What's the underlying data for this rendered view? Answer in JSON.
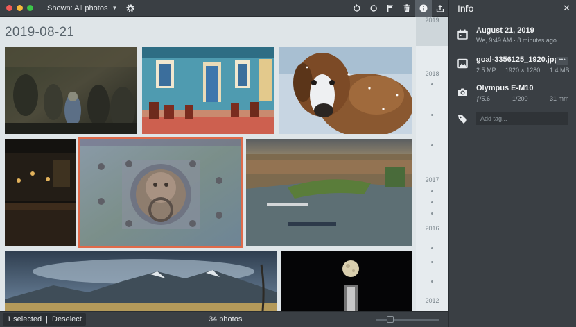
{
  "toolbar": {
    "shown_label": "Shown: All photos",
    "window_controls": [
      "#f25b57",
      "#f6b93b",
      "#3cc64a"
    ],
    "right_icons": [
      "rotate-left-icon",
      "rotate-right-icon",
      "flag-icon",
      "trash-icon",
      "info-icon",
      "share-icon"
    ]
  },
  "content": {
    "date_header": "2019-08-21"
  },
  "timeline": {
    "years": [
      "2019",
      "2018",
      "2017",
      "2016",
      "2012"
    ]
  },
  "status": {
    "selected_label": "1 selected",
    "deselect_label": "Deselect",
    "count": "34 photos",
    "zoom_level": 0.2
  },
  "info": {
    "title": "Info",
    "date": {
      "title": "August 21, 2019",
      "subtitle": "We, 9:49 AM · 8 minutes ago"
    },
    "file": {
      "name": "goal-3356125_1920.jpg",
      "megapixels": "2.5 MP",
      "dimensions": "1920 × 1280",
      "size": "1.4 MB"
    },
    "camera": {
      "model": "Olympus E-M10",
      "aperture": "ƒ/5.6",
      "shutter": "1/200",
      "focal": "31 mm"
    },
    "tag_placeholder": "Add tag..."
  },
  "colors": {
    "selection": "#e06a4a",
    "panel": "#3a3f44",
    "content_bg": "#dfe5e8"
  }
}
